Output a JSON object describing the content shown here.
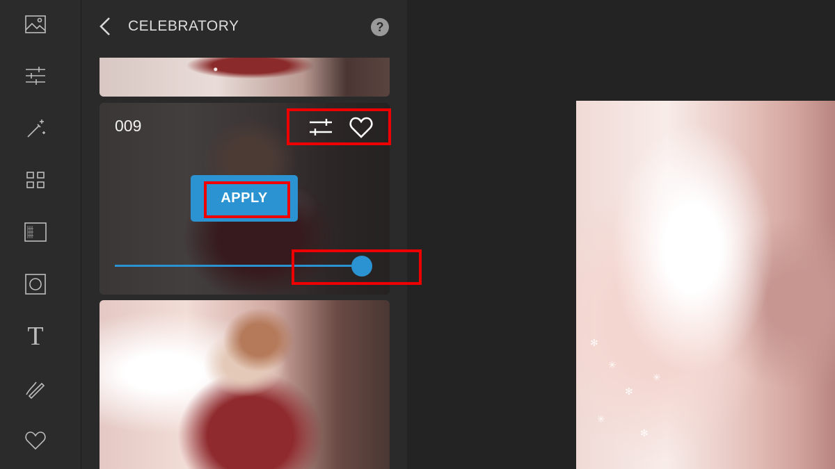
{
  "rail": {
    "icons": [
      "image-icon",
      "adjust-icon",
      "magic-wand-icon",
      "grid-icon",
      "texture-icon",
      "frame-icon",
      "text-icon",
      "draw-icon",
      "heart-icon"
    ],
    "text_icon_glyph": "T"
  },
  "panel": {
    "title": "CELEBRATORY",
    "help_glyph": "?"
  },
  "card": {
    "number": "009",
    "apply_label": "APPLY",
    "slider_value_percent": 100
  },
  "colors": {
    "accent": "#2b93d1",
    "highlight": "#ee0000",
    "rail_bg": "#2b2b2b",
    "panel_bg": "#2a2a2a",
    "app_bg": "#232323"
  }
}
